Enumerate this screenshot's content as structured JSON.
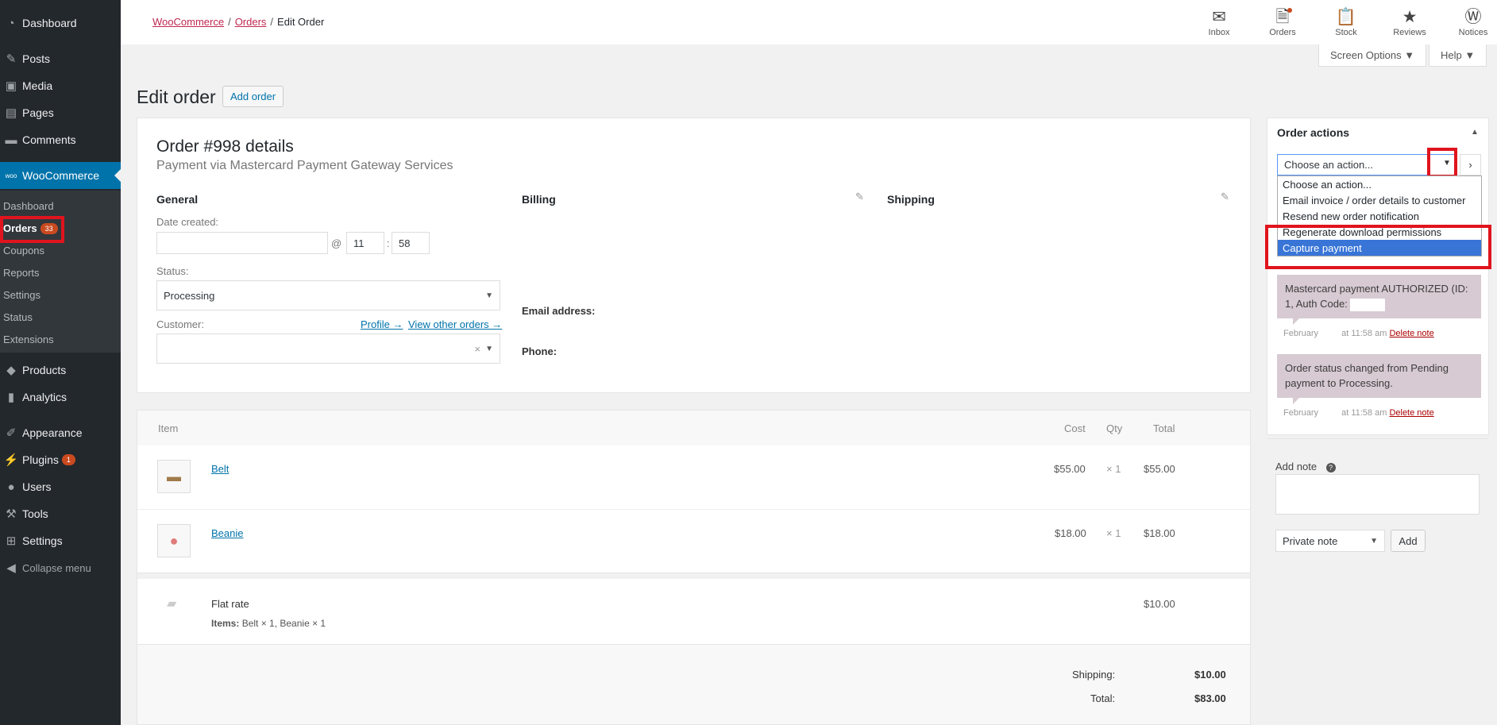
{
  "sidebar": {
    "items": [
      {
        "label": "Dashboard",
        "icon": "dashboard-icon"
      },
      {
        "label": "Posts",
        "icon": "pushpin-icon"
      },
      {
        "label": "Media",
        "icon": "media-icon"
      },
      {
        "label": "Pages",
        "icon": "pages-icon"
      },
      {
        "label": "Comments",
        "icon": "comment-icon"
      },
      {
        "label": "WooCommerce",
        "icon": "woo-icon"
      },
      {
        "label": "Products",
        "icon": "products-icon"
      },
      {
        "label": "Analytics",
        "icon": "analytics-icon"
      },
      {
        "label": "Appearance",
        "icon": "brush-icon"
      },
      {
        "label": "Plugins",
        "icon": "plugin-icon",
        "badge": "1"
      },
      {
        "label": "Users",
        "icon": "user-icon"
      },
      {
        "label": "Tools",
        "icon": "wrench-icon"
      },
      {
        "label": "Settings",
        "icon": "settings-icon"
      },
      {
        "label": "Collapse menu",
        "icon": "collapse-icon"
      }
    ],
    "submenu": [
      {
        "label": "Dashboard"
      },
      {
        "label": "Orders",
        "badge": "33"
      },
      {
        "label": "Coupons"
      },
      {
        "label": "Reports"
      },
      {
        "label": "Settings"
      },
      {
        "label": "Status"
      },
      {
        "label": "Extensions"
      }
    ]
  },
  "breadcrumb": {
    "woocommerce": "WooCommerce",
    "orders": "Orders",
    "current": "Edit Order",
    "sep": "/"
  },
  "top_actions": [
    {
      "label": "Inbox",
      "icon": "inbox-icon"
    },
    {
      "label": "Orders",
      "icon": "orders-icon"
    },
    {
      "label": "Stock",
      "icon": "stock-icon"
    },
    {
      "label": "Reviews",
      "icon": "star-icon"
    },
    {
      "label": "Notices",
      "icon": "wordpress-icon"
    }
  ],
  "screen_options": "Screen Options ▼",
  "help": "Help ▼",
  "page_title": "Edit order",
  "add_order": "Add order",
  "order": {
    "heading": "Order #998 details",
    "payment_via": "Payment via Mastercard Payment Gateway Services",
    "general": "General",
    "billing": "Billing",
    "shipping": "Shipping",
    "date_created_label": "Date created:",
    "at": "@",
    "colon": ":",
    "hour": "11",
    "minute": "58",
    "status_label": "Status:",
    "status_value": "Processing",
    "customer_label": "Customer:",
    "profile_link": "Profile →",
    "view_orders_link": "View other orders →",
    "clear": "×",
    "email_label": "Email address:",
    "phone_label": "Phone:"
  },
  "items_table": {
    "headers": {
      "item": "Item",
      "cost": "Cost",
      "qty": "Qty",
      "total": "Total"
    },
    "rows": [
      {
        "name": "Belt",
        "cost": "$55.00",
        "qty": "× 1",
        "total": "$55.00"
      },
      {
        "name": "Beanie",
        "cost": "$18.00",
        "qty": "× 1",
        "total": "$18.00"
      }
    ],
    "shipping_line": {
      "name": "Flat rate",
      "items_label": "Items:",
      "items_value": "Belt × 1, Beanie × 1",
      "total": "$10.00"
    },
    "totals": {
      "shipping_label": "Shipping:",
      "shipping_value": "$10.00",
      "total_label": "Total:",
      "total_value": "$83.00"
    }
  },
  "order_actions": {
    "title": "Order actions",
    "collapse": "▲",
    "selected": "Choose an action...",
    "go": "›",
    "options": [
      "Choose an action...",
      "Email invoice / order details to customer",
      "Resend new order notification",
      "Regenerate download permissions",
      "Capture payment"
    ]
  },
  "notes": [
    {
      "text": "Mastercard payment AUTHORIZED (ID: 1, Auth Code:",
      "date": "February",
      "time": "at 11:58 am",
      "delete": "Delete note"
    },
    {
      "text": "Order status changed from Pending payment to Processing.",
      "date": "February",
      "time": "at 11:58 am",
      "delete": "Delete note"
    }
  ],
  "add_note": {
    "label": "Add note",
    "help": "?",
    "type_value": "Private note",
    "add_button": "Add"
  }
}
